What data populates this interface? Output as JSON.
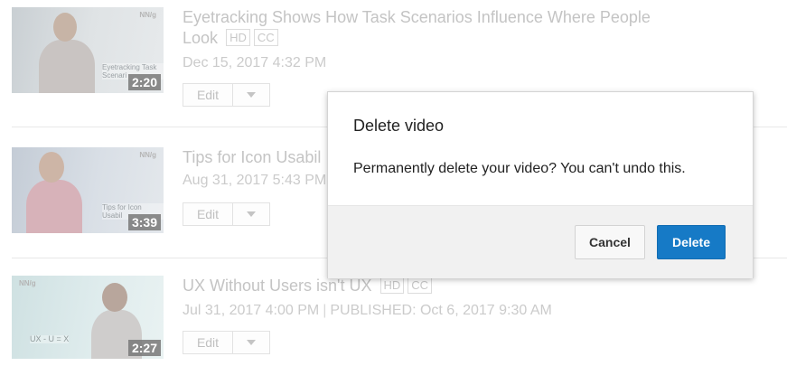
{
  "videos": [
    {
      "title": "Eyetracking Shows How Task Scenarios Influence Where People Look",
      "title_line1": "Eyetracking Shows How Task Scenarios Influence Where People",
      "title_line2": "Look",
      "badges": [
        "HD",
        "CC"
      ],
      "date": "Dec 15, 2017 4:32 PM",
      "duration": "2:20",
      "thumb_brand": "NN/g",
      "thumb_caption": "Eyetracking Task Scenari",
      "edit_label": "Edit"
    },
    {
      "title": "Tips for Icon Usabil",
      "badges": [],
      "date": "Aug 31, 2017 5:43 PM",
      "duration": "3:39",
      "thumb_brand": "NN/g",
      "thumb_caption": "Tips for Icon Usabil",
      "edit_label": "Edit"
    },
    {
      "title": "UX Without Users isn't UX",
      "badges": [
        "HD",
        "CC"
      ],
      "date": "Jul 31, 2017 4:00 PM",
      "separator": "|",
      "published": "PUBLISHED: Oct 6, 2017 9:30 AM",
      "duration": "2:27",
      "thumb_brand": "NN/g",
      "thumb_caption": "UX - U = X",
      "edit_label": "Edit"
    }
  ],
  "dialog": {
    "title": "Delete video",
    "message": "Permanently delete your video? You can't undo this.",
    "cancel_label": "Cancel",
    "delete_label": "Delete"
  },
  "colors": {
    "delete_button": "#167ac6",
    "muted_text": "#c4c4c4"
  }
}
